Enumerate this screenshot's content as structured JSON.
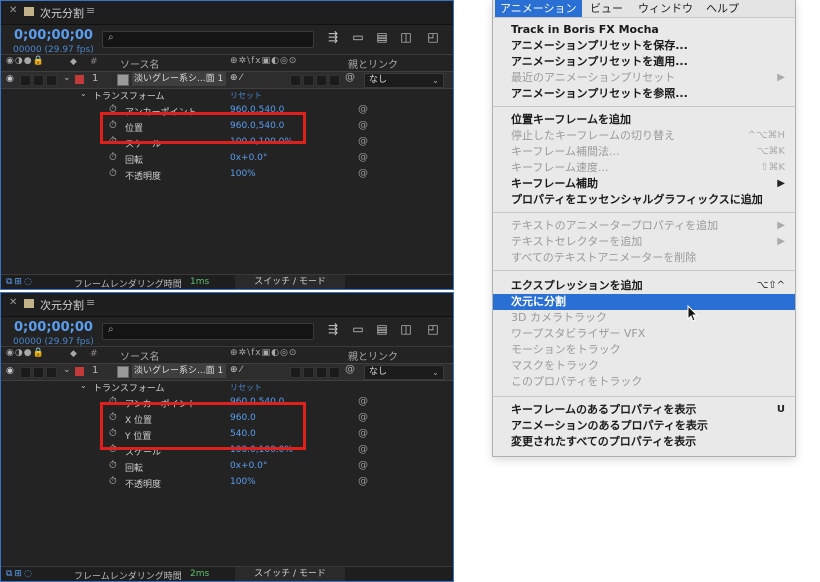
{
  "top_panel": {
    "tab_title": "次元分割",
    "timecode": "0;00;00;00",
    "fps": "00000 (29.97 fps)",
    "header": {
      "src": "ソース名",
      "parent": "親とリンク",
      "hash": "#"
    },
    "layer": {
      "num": "1",
      "name": "淡いグレー系シ...面 1",
      "parent": "なし"
    },
    "transform_label": "トランスフォーム",
    "reset_label": "リセット",
    "props": [
      {
        "name": "アンカーポイント",
        "value": "960.0,540.0"
      },
      {
        "name": "位置",
        "value": "960.0,540.0"
      },
      {
        "name": "スケール",
        "value": "100.0,100.0%"
      },
      {
        "name": "回転",
        "value": "0x+0.0°"
      },
      {
        "name": "不透明度",
        "value": "100%"
      }
    ],
    "footer": {
      "render": "フレームレンダリング時間",
      "ms": "1ms",
      "switch": "スイッチ / モード"
    }
  },
  "bottom_panel": {
    "tab_title": "次元分割",
    "timecode": "0;00;00;00",
    "fps": "00000 (29.97 fps)",
    "header": {
      "src": "ソース名",
      "parent": "親とリンク",
      "hash": "#"
    },
    "layer": {
      "num": "1",
      "name": "淡いグレー系シ...面 1",
      "parent": "なし"
    },
    "transform_label": "トランスフォーム",
    "reset_label": "リセット",
    "props": [
      {
        "name": "アンカーポイント",
        "value": "960.0,540.0"
      },
      {
        "name": "X 位置",
        "value": "960.0"
      },
      {
        "name": "Y 位置",
        "value": "540.0"
      },
      {
        "name": "スケール",
        "value": "100.0,100.0%"
      },
      {
        "name": "回転",
        "value": "0x+0.0°"
      },
      {
        "name": "不透明度",
        "value": "100%"
      }
    ],
    "footer": {
      "render": "フレームレンダリング時間",
      "ms": "2ms",
      "switch": "スイッチ / モード"
    }
  },
  "menu": {
    "bar": [
      "アニメーション",
      "ビュー",
      "ウィンドウ",
      "ヘルプ"
    ],
    "items": [
      {
        "label": "Track in Boris FX Mocha",
        "shortcut": ""
      },
      {
        "label": "アニメーションプリセットを保存...",
        "shortcut": ""
      },
      {
        "label": "アニメーションプリセットを適用...",
        "shortcut": ""
      },
      {
        "label": "最近のアニメーションプリセット",
        "shortcut": "▶"
      },
      {
        "label": "アニメーションプリセットを参照...",
        "shortcut": ""
      },
      {
        "label": "位置キーフレームを追加",
        "shortcut": ""
      },
      {
        "label": "停止したキーフレームの切り替え",
        "shortcut": "^⌥⌘H"
      },
      {
        "label": "キーフレーム補間法...",
        "shortcut": "⌥⌘K"
      },
      {
        "label": "キーフレーム速度...",
        "shortcut": "⇧⌘K"
      },
      {
        "label": "キーフレーム補助",
        "shortcut": "▶"
      },
      {
        "label": "プロパティをエッセンシャルグラフィックスに追加",
        "shortcut": ""
      },
      {
        "label": "テキストのアニメータープロパティを追加",
        "shortcut": "▶"
      },
      {
        "label": "テキストセレクターを追加",
        "shortcut": "▶"
      },
      {
        "label": "すべてのテキストアニメーターを削除",
        "shortcut": ""
      },
      {
        "label": "エクスプレッションを追加",
        "shortcut": "⌥⇧^"
      },
      {
        "label": "次元に分割",
        "shortcut": ""
      },
      {
        "label": "3D カメラトラック",
        "shortcut": ""
      },
      {
        "label": "ワープスタビライザー VFX",
        "shortcut": ""
      },
      {
        "label": "モーションをトラック",
        "shortcut": ""
      },
      {
        "label": "マスクをトラック",
        "shortcut": ""
      },
      {
        "label": "このプロパティをトラック",
        "shortcut": ""
      },
      {
        "label": "キーフレームのあるプロパティを表示",
        "shortcut": "U"
      },
      {
        "label": "アニメーションのあるプロパティを表示",
        "shortcut": ""
      },
      {
        "label": "変更されたすべてのプロパティを表示",
        "shortcut": ""
      }
    ]
  }
}
